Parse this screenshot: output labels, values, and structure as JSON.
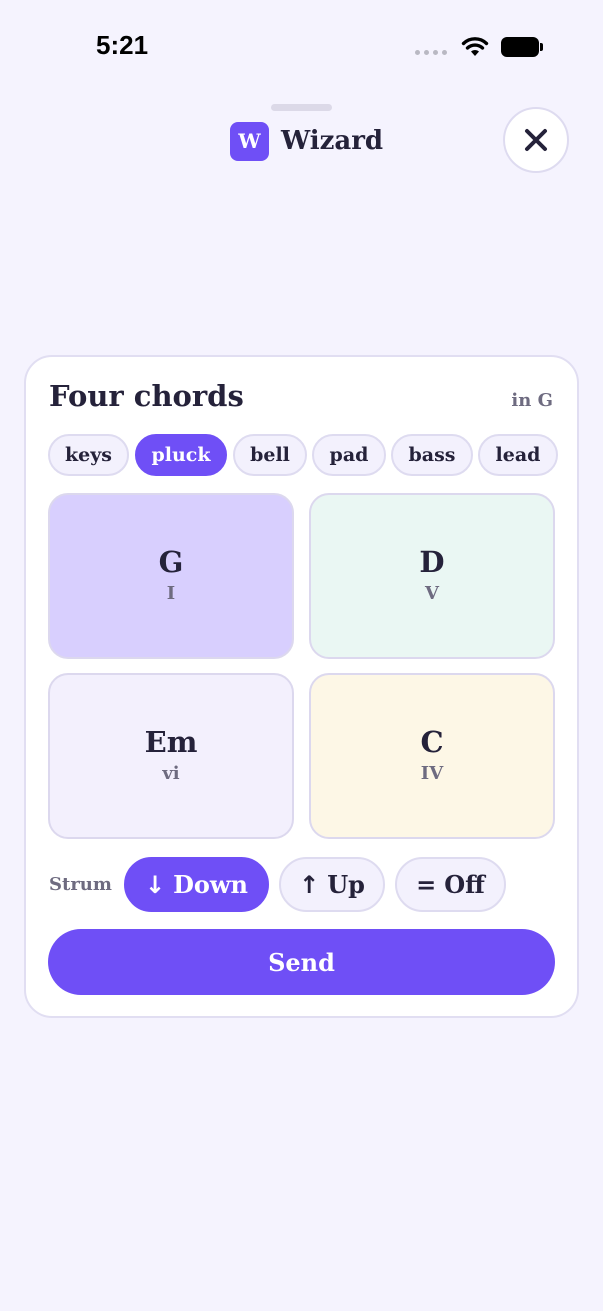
{
  "status_bar": {
    "time": "5:21"
  },
  "header": {
    "app_icon_letter": "W",
    "app_name": "Wizard",
    "close_icon": "close-icon"
  },
  "card": {
    "title": "Four chords",
    "key": "in G",
    "sounds": [
      {
        "label": "keys",
        "selected": false
      },
      {
        "label": "pluck",
        "selected": true
      },
      {
        "label": "bell",
        "selected": false
      },
      {
        "label": "pad",
        "selected": false
      },
      {
        "label": "bass",
        "selected": false
      },
      {
        "label": "lead",
        "selected": false
      }
    ],
    "chords": [
      {
        "name": "G",
        "degree": "I",
        "color": "#d8cffe"
      },
      {
        "name": "D",
        "degree": "V",
        "color": "#eaf7f3"
      },
      {
        "name": "Em",
        "degree": "vi",
        "color": "#f3f0fd"
      },
      {
        "name": "C",
        "degree": "IV",
        "color": "#fdf7e6"
      }
    ],
    "strum": {
      "label": "Strum",
      "options": [
        {
          "symbol": "↓",
          "label": "Down",
          "selected": true
        },
        {
          "symbol": "↑",
          "label": "Up",
          "selected": false
        },
        {
          "symbol": "=",
          "label": "Off",
          "selected": false
        }
      ]
    },
    "send_label": "Send"
  },
  "colors": {
    "accent": "#6f4ff6",
    "background": "#f5f3fe",
    "text": "#25223a",
    "muted": "#6e6b80"
  }
}
